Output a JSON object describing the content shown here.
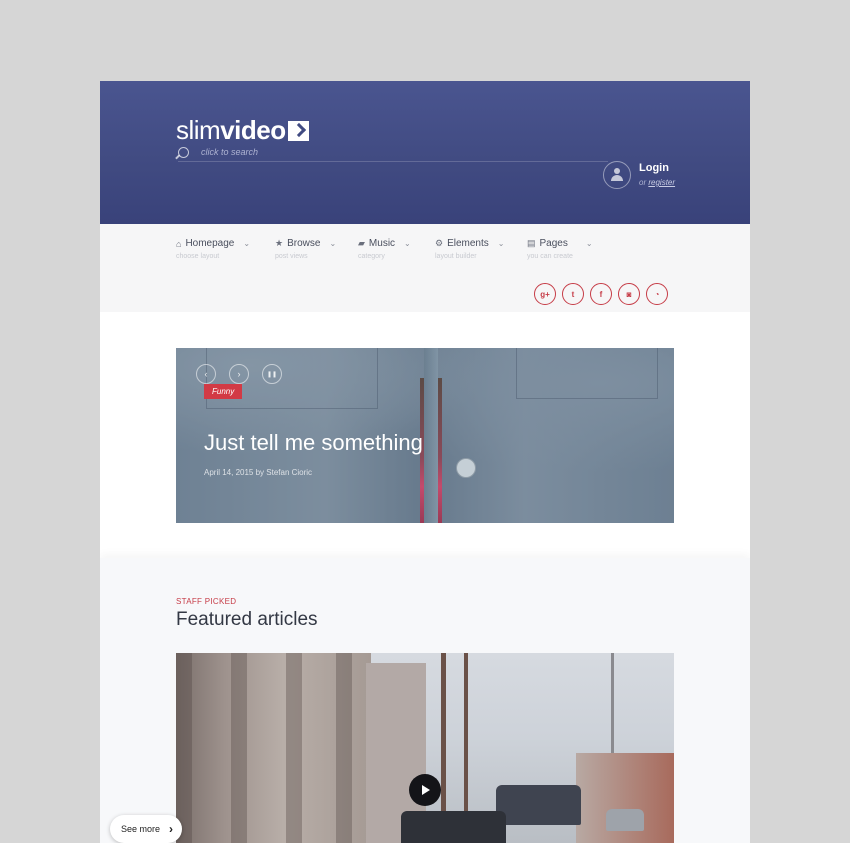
{
  "brand": {
    "slim": "slim",
    "video": "video"
  },
  "search": {
    "placeholder": "click to search"
  },
  "account": {
    "login": "Login",
    "or": "or",
    "register": "register"
  },
  "nav": [
    {
      "icon": "home-icon",
      "glyph": "⌂",
      "label": "Homepage",
      "sub": "choose layout"
    },
    {
      "icon": "star-icon",
      "glyph": "★",
      "label": "Browse",
      "sub": "post views"
    },
    {
      "icon": "folder-icon",
      "glyph": "▰",
      "label": "Music",
      "sub": "category"
    },
    {
      "icon": "elements-icon",
      "glyph": "⚙",
      "label": "Elements",
      "sub": "layout builder"
    },
    {
      "icon": "page-icon",
      "glyph": "▤",
      "label": "Pages",
      "sub": "you can create"
    }
  ],
  "socials": [
    {
      "icon": "google-plus-icon",
      "glyph": "g+"
    },
    {
      "icon": "twitter-icon",
      "glyph": "t"
    },
    {
      "icon": "facebook-icon",
      "glyph": "f"
    },
    {
      "icon": "instagram-icon",
      "glyph": "◙"
    },
    {
      "icon": "rss-icon",
      "glyph": "◔"
    }
  ],
  "hero": {
    "prev": "‹",
    "next": "›",
    "pause": "❚❚",
    "tag": "Funny",
    "title": "Just tell me something",
    "meta": "April 14, 2015 by Stefan Cioric"
  },
  "featured": {
    "kicker": "STAFF PICKED",
    "title": "Featured articles"
  },
  "see_more": "See more",
  "colors": {
    "header": "#414b82",
    "accent": "#c63c47",
    "tag": "#d23a45"
  }
}
